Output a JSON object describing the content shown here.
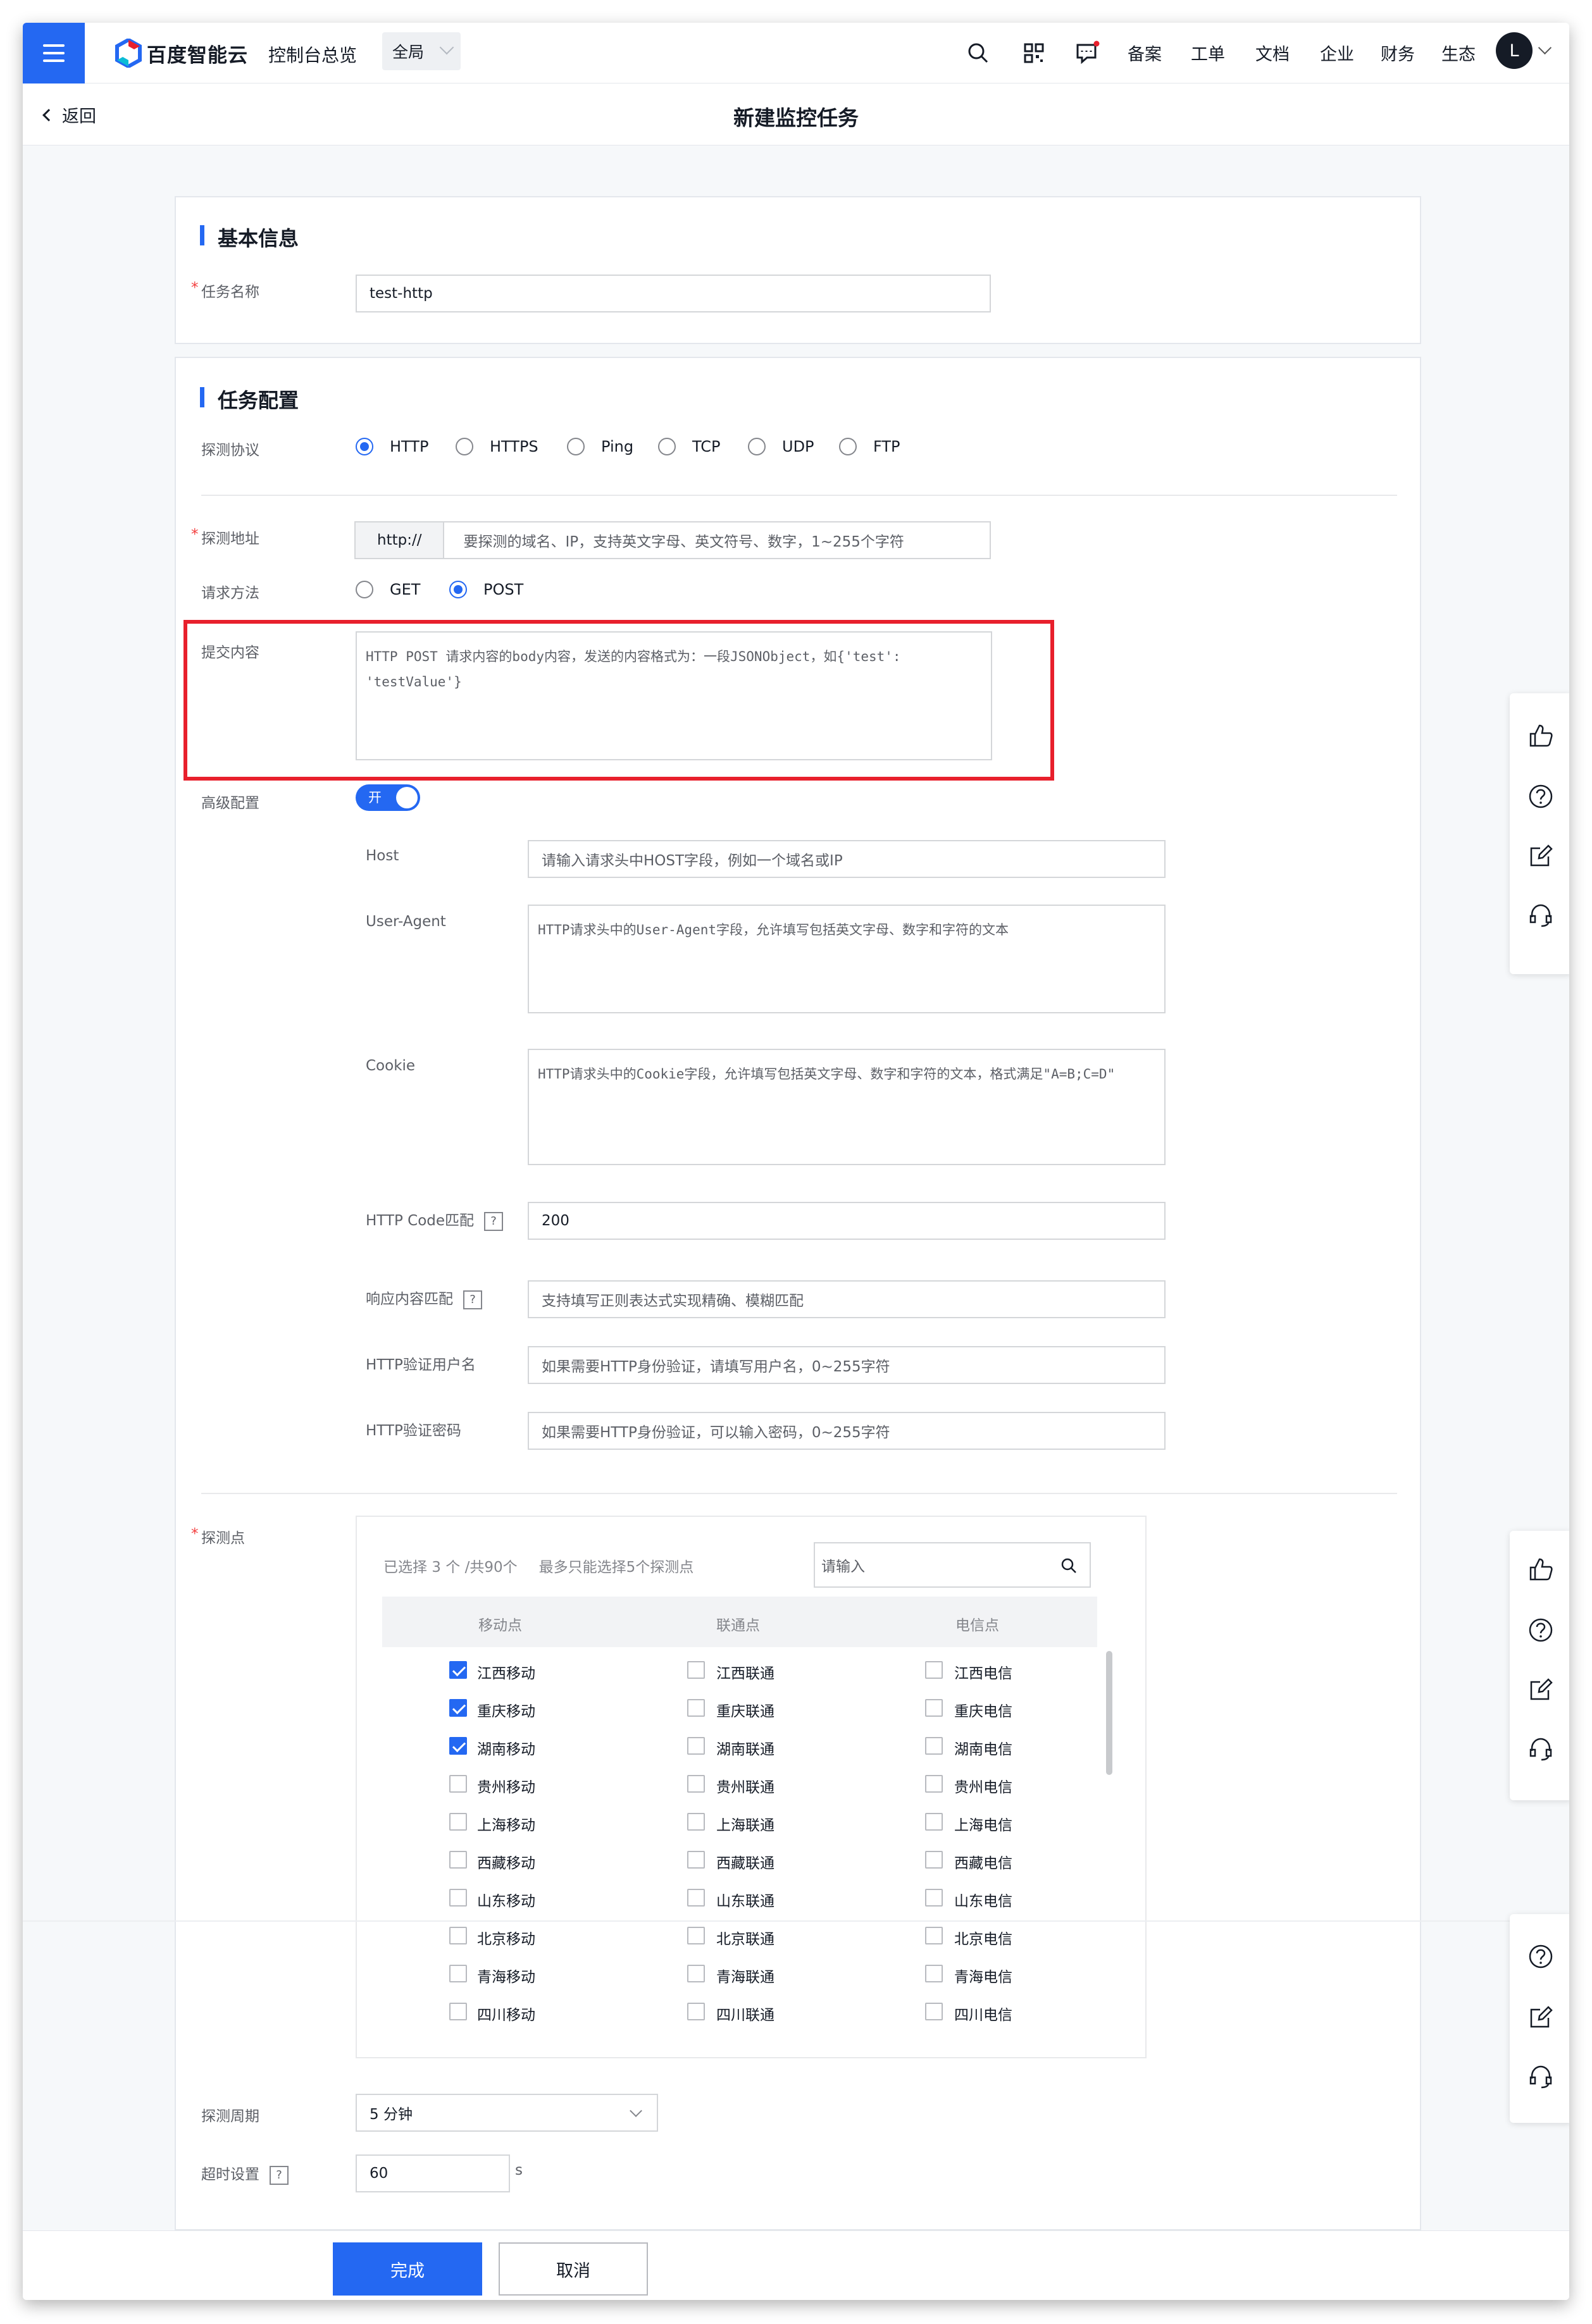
{
  "topbar": {
    "brand": "百度智能云",
    "console": "控制台总览",
    "region": "全局",
    "nav": [
      "备案",
      "工单",
      "文档",
      "企业",
      "财务",
      "生态"
    ],
    "avatar_letter": "L",
    "icons": [
      "search-icon",
      "qrcode-icon",
      "message-icon"
    ],
    "accent_color": "#2468f2"
  },
  "titlebar": {
    "back": "返回",
    "title": "新建监控任务"
  },
  "basic": {
    "section": "基本信息",
    "name_label": "任务名称",
    "name_value": "test-http"
  },
  "config": {
    "section": "任务配置",
    "protocol_label": "探测协议",
    "protocols": [
      "HTTP",
      "HTTPS",
      "Ping",
      "TCP",
      "UDP",
      "FTP"
    ],
    "protocol_selected": "HTTP",
    "address_label": "探测地址",
    "address_prefix": "http://",
    "address_placeholder": "要探测的域名、IP，支持英文字母、英文符号、数字，1~255个字符",
    "method_label": "请求方法",
    "methods": [
      "GET",
      "POST"
    ],
    "method_selected": "POST",
    "body_label": "提交内容",
    "body_placeholder": "HTTP POST 请求内容的body内容，发送的内容格式为：一段JSONObject，如{'test': 'testValue'}",
    "advanced_label": "高级配置",
    "advanced_toggle": "开",
    "host_label": "Host",
    "host_placeholder": "请输入请求头中HOST字段，例如一个域名或IP",
    "ua_label": "User-Agent",
    "ua_placeholder": "HTTP请求头中的User-Agent字段，允许填写包括英文字母、数字和字符的文本",
    "cookie_label": "Cookie",
    "cookie_placeholder": "HTTP请求头中的Cookie字段，允许填写包括英文字母、数字和字符的文本，格式满足\"A=B;C=D\"",
    "code_label": "HTTP Code匹配",
    "code_value": "200",
    "resp_label": "响应内容匹配",
    "resp_placeholder": "支持填写正则表达式实现精确、模糊匹配",
    "user_label": "HTTP验证用户名",
    "user_placeholder": "如果需要HTTP身份验证，请填写用户名，0~255字符",
    "pwd_label": "HTTP验证密码",
    "pwd_placeholder": "如果需要HTTP身份验证，可以输入密码，0~255字符",
    "help_mark": "?"
  },
  "probe": {
    "label": "探测点",
    "selected_info": "已选择 3 个 /共90个",
    "limit_info": "最多只能选择5个探测点",
    "search_placeholder": "请输入",
    "columns": [
      "移动点",
      "联通点",
      "电信点"
    ],
    "rows": [
      {
        "mobile": "江西移动",
        "unicom": "江西联通",
        "telecom": "江西电信",
        "checked": true
      },
      {
        "mobile": "重庆移动",
        "unicom": "重庆联通",
        "telecom": "重庆电信",
        "checked": true
      },
      {
        "mobile": "湖南移动",
        "unicom": "湖南联通",
        "telecom": "湖南电信",
        "checked": true
      },
      {
        "mobile": "贵州移动",
        "unicom": "贵州联通",
        "telecom": "贵州电信",
        "checked": false
      },
      {
        "mobile": "上海移动",
        "unicom": "上海联通",
        "telecom": "上海电信",
        "checked": false
      },
      {
        "mobile": "西藏移动",
        "unicom": "西藏联通",
        "telecom": "西藏电信",
        "checked": false
      },
      {
        "mobile": "山东移动",
        "unicom": "山东联通",
        "telecom": "山东电信",
        "checked": false
      },
      {
        "mobile": "北京移动",
        "unicom": "北京联通",
        "telecom": "北京电信",
        "checked": false
      },
      {
        "mobile": "青海移动",
        "unicom": "青海联通",
        "telecom": "青海电信",
        "checked": false
      },
      {
        "mobile": "四川移动",
        "unicom": "四川联通",
        "telecom": "四川电信",
        "checked": false
      }
    ]
  },
  "period": {
    "label": "探测周期",
    "value": "5 分钟"
  },
  "timeout": {
    "label": "超时设置",
    "value": "60",
    "unit": "s"
  },
  "actions": {
    "submit": "完成",
    "cancel": "取消"
  },
  "side_icons": [
    "thumbs-up-icon",
    "help-icon",
    "edit-icon",
    "headset-icon"
  ]
}
